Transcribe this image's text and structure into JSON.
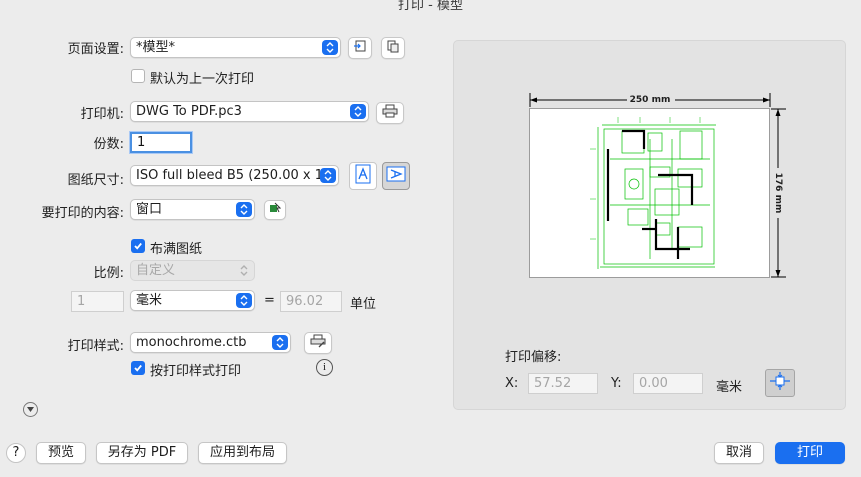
{
  "window": {
    "title": "打印 - 模型"
  },
  "page_setup": {
    "label": "页面设置:",
    "value": "*模型*"
  },
  "default_last": {
    "label": "默认为上一次打印",
    "checked": false
  },
  "printer": {
    "label": "打印机:",
    "value": "DWG To PDF.pc3"
  },
  "copies": {
    "label": "份数:",
    "value": "1"
  },
  "paper_size": {
    "label": "图纸尺寸:",
    "value": "ISO full bleed B5 (250.00 x 1..."
  },
  "print_area": {
    "label": "要打印的内容:",
    "value": "窗口"
  },
  "fit_paper": {
    "label": "布满图纸",
    "checked": true
  },
  "scale": {
    "label": "比例:",
    "value": "自定义",
    "left_value": "1",
    "unit": "毫米",
    "equals": "=",
    "right_value": "96.02",
    "right_unit": "单位"
  },
  "plot_style": {
    "label": "打印样式:",
    "value": "monochrome.ctb"
  },
  "print_with_styles": {
    "label": "按打印样式打印",
    "checked": true
  },
  "preview": {
    "width_dim": "250 mm",
    "height_dim": "176 mm",
    "offset_label": "打印偏移:",
    "x_label": "X:",
    "x_value": "57.52",
    "y_label": "Y:",
    "y_value": "0.00",
    "unit": "毫米"
  },
  "footer": {
    "help": "?",
    "preview": "预览",
    "save_pdf": "另存为 PDF",
    "apply_layout": "应用到布局",
    "cancel": "取消",
    "print": "打印"
  },
  "colors": {
    "accent": "#1a6ff0",
    "drawing": "#00c000"
  }
}
